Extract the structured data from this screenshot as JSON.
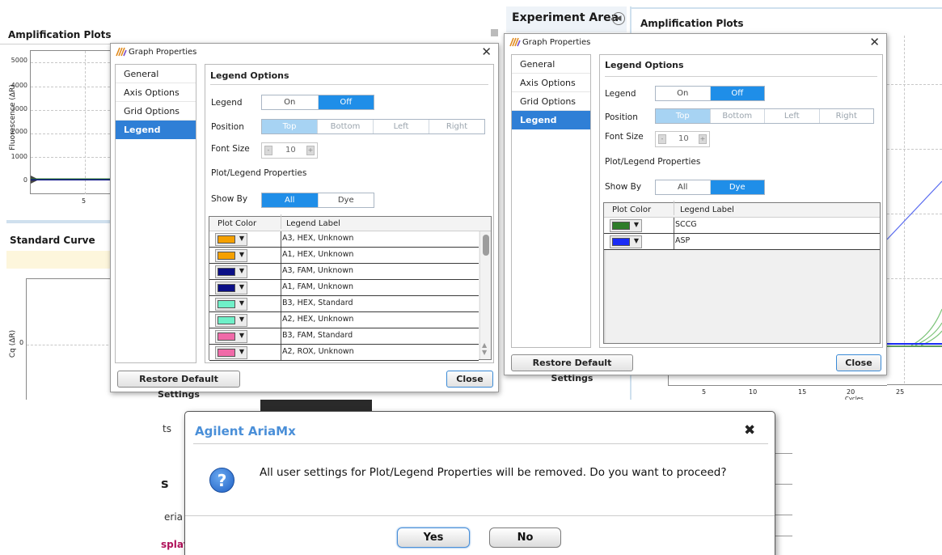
{
  "left_app": {
    "amplification_title": "Amplification Plots",
    "y_axis_label": "Fluorescence (ΔR)",
    "y_ticks": [
      "5000",
      "4000",
      "3000",
      "2000",
      "1000",
      "0"
    ],
    "x_tick": "5",
    "standard_curve_title": "Standard Curve",
    "cq_axis_label": "Cq (ΔR)",
    "cq_tick": "0"
  },
  "dialog1": {
    "title": "Graph Properties",
    "close_glyph": "✕",
    "nav": [
      "General",
      "Axis Options",
      "Grid Options",
      "Legend Options"
    ],
    "section_title": "Legend Options",
    "legend_label": "Legend",
    "legend_options": [
      "On",
      "Off"
    ],
    "legend_selected": "Off",
    "position_label": "Position",
    "position_options": [
      "Top",
      "Bottom",
      "Left",
      "Right"
    ],
    "position_selected": "Top",
    "font_size_label": "Font Size",
    "font_size_value": "10",
    "props_label": "Plot/Legend Properties",
    "show_by_label": "Show By",
    "show_by_options": [
      "All",
      "Dye"
    ],
    "show_by_selected": "All",
    "grid_headers": [
      "Plot Color",
      "Legend Label"
    ],
    "rows": [
      {
        "color": "#f5a000",
        "label": "A3, HEX, Unknown"
      },
      {
        "color": "#f5a000",
        "label": "A1, HEX, Unknown"
      },
      {
        "color": "#0b0f86",
        "label": "A3, FAM, Unknown"
      },
      {
        "color": "#0b0f86",
        "label": "A1, FAM, Unknown"
      },
      {
        "color": "#6ff0c8",
        "label": "B3, HEX, Standard"
      },
      {
        "color": "#6ff0c8",
        "label": "A2, HEX, Unknown"
      },
      {
        "color": "#f06aa8",
        "label": "B3, FAM, Standard"
      },
      {
        "color": "#f06aa8",
        "label": "A2, ROX, Unknown"
      }
    ],
    "restore_label": "Restore Default Settings",
    "close_label": "Close"
  },
  "right_app": {
    "experiment_area": "Experiment Area",
    "amplification_title": "Amplification Plots",
    "x_ticks": [
      "5",
      "10",
      "15",
      "20",
      "25"
    ],
    "x_axis_label": "Cycles"
  },
  "dialog2": {
    "title": "Graph Properties",
    "close_glyph": "✕",
    "nav": [
      "General",
      "Axis Options",
      "Grid Options",
      "Legend Options"
    ],
    "section_title": "Legend Options",
    "legend_label": "Legend",
    "legend_options": [
      "On",
      "Off"
    ],
    "legend_selected": "Off",
    "position_label": "Position",
    "position_options": [
      "Top",
      "Bottom",
      "Left",
      "Right"
    ],
    "position_selected": "Top",
    "font_size_label": "Font Size",
    "font_size_value": "10",
    "props_label": "Plot/Legend Properties",
    "show_by_label": "Show By",
    "show_by_options": [
      "All",
      "Dye"
    ],
    "show_by_selected": "Dye",
    "grid_headers": [
      "Plot Color",
      "Legend Label"
    ],
    "rows": [
      {
        "color": "#2e7d2a",
        "label": "SCCG"
      },
      {
        "color": "#1a2cf5",
        "label": "ASP"
      }
    ],
    "restore_label": "Restore Default Settings",
    "close_label": "Close"
  },
  "confirm": {
    "title": "Agilent AriaMx",
    "close_glyph": "✖",
    "message": "All user settings for Plot/Legend Properties will be removed. Do you want to proceed?",
    "yes_label": "Yes",
    "no_label": "No",
    "bg_fragments": [
      "ts",
      "s",
      "eria",
      "splay"
    ]
  },
  "colors": {
    "accent": "#1f8ee8",
    "nav_active": "#2f7fd6",
    "confirm_title": "#4a8fd8",
    "bg_banner": "#fdf6dc"
  }
}
